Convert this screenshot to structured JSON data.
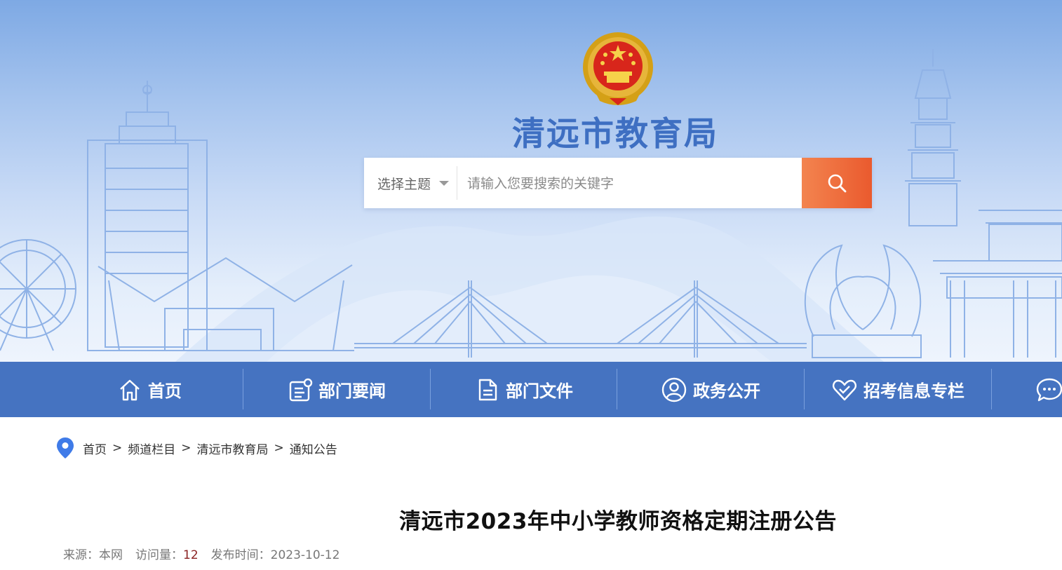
{
  "site": {
    "title": "清远市教育局",
    "emblem_icon": "national-emblem-icon"
  },
  "search": {
    "topic_label": "选择主题",
    "placeholder": "请输入您要搜索的关键字",
    "button_icon": "search-icon"
  },
  "nav": {
    "items": [
      {
        "label": "首页",
        "icon": "home-icon"
      },
      {
        "label": "部门要闻",
        "icon": "news-icon"
      },
      {
        "label": "部门文件",
        "icon": "document-icon"
      },
      {
        "label": "政务公开",
        "icon": "user-circle-icon"
      },
      {
        "label": "招考信息专栏",
        "icon": "heart-icon"
      },
      {
        "label": "",
        "icon": "chat-icon"
      }
    ]
  },
  "breadcrumb": {
    "icon": "location-pin-icon",
    "items": [
      "首页",
      "频道栏目",
      "清远市教育局",
      "通知公告"
    ],
    "separator": ">"
  },
  "article": {
    "title": "清远市2023年中小学教师资格定期注册公告",
    "source_label": "来源：",
    "source_value": "本网",
    "views_label": "访问量：",
    "views_value": "12",
    "date_label": "发布时间：",
    "date_value": "2023-10-12"
  },
  "colors": {
    "nav_bg": "#4573c1",
    "title_blue": "#3e6fc2",
    "search_button": "#ea5a2e",
    "pin_blue": "#3f7be8",
    "views_value": "#8b2323"
  }
}
